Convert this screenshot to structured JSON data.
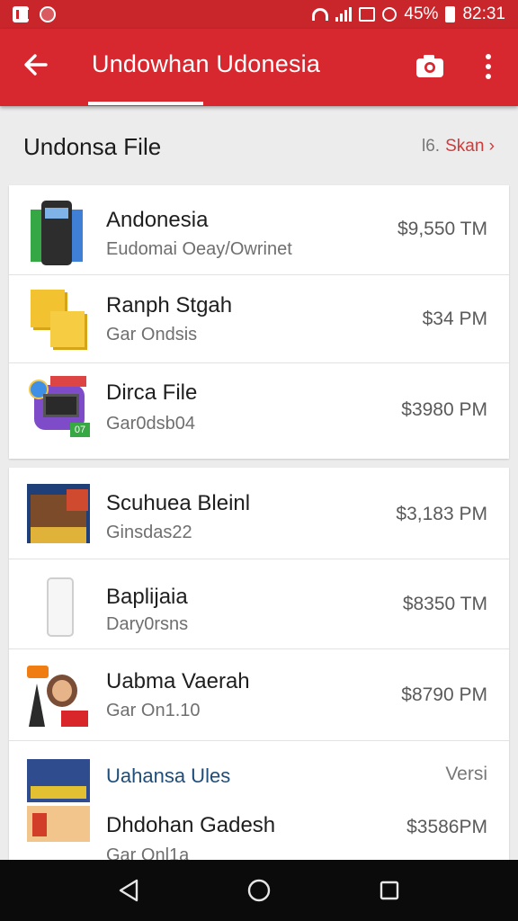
{
  "status_bar": {
    "battery": "45%",
    "time": "82:31"
  },
  "app_bar": {
    "title": "Undowhan Udonesia"
  },
  "section": {
    "title": "Undonsa File",
    "count": "l6.",
    "link": "Skan ›"
  },
  "list_top": [
    {
      "title": "Andonesia",
      "subtitle": "Eudomai Oeay/Owrinet",
      "price": "$9,550 TM"
    },
    {
      "title": "Ranph Stgah",
      "subtitle": "Gar Ondsis",
      "price": "$34 PM"
    },
    {
      "title": "Dirca File",
      "subtitle": "Gar0dsb04",
      "price": "$3980 PM",
      "thumb_tag": "07"
    }
  ],
  "list_bottom": [
    {
      "title": "Scuhuea Bleinl",
      "subtitle": "Ginsdas22",
      "price": "$3,183 PM"
    },
    {
      "title": "Baplijaia",
      "subtitle": "Dary0rsns",
      "price": "$8350 TM"
    },
    {
      "title": "Uabma Vaerah",
      "subtitle": "Gar On1.10",
      "price": "$8790 PM"
    }
  ],
  "footer_row": {
    "header": "Uahansa Ules",
    "header_right": "Versi",
    "title": "Dhdohan Gadesh",
    "subtitle": "Gar Onl1a",
    "price": "$3586PM"
  },
  "icons": {
    "back": "arrow-left-icon",
    "camera": "camera-icon",
    "more": "more-vert-icon",
    "nav_back": "triangle-back-icon",
    "nav_home": "circle-home-icon",
    "nav_recents": "square-recents-icon"
  },
  "colors": {
    "app_bar": "#d7282f",
    "status_bar": "#c8262b",
    "accent_link": "#d23a3a",
    "nav_bar": "#0b0b0b"
  }
}
